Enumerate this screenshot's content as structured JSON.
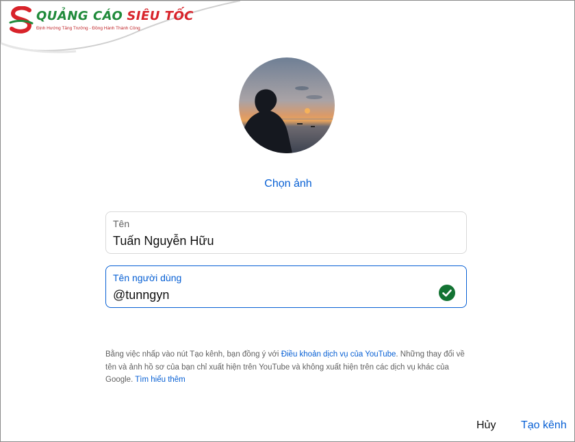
{
  "logo": {
    "brand_part1": "QUẢNG CÁO",
    "brand_part2": "SIÊU TỐC",
    "slogan": "Định Hướng Tăng Trưởng - Đồng Hành Thành Công",
    "colors": {
      "green": "#1f8a3a",
      "red": "#d8232a"
    }
  },
  "profile": {
    "choose_photo_label": "Chọn ảnh"
  },
  "form": {
    "name_label": "Tên",
    "name_value": "Tuấn Nguyễn Hữu",
    "username_label": "Tên người dùng",
    "username_value": "@tunngyn",
    "username_status_icon": "check-circle-icon"
  },
  "terms": {
    "text_before": "Bằng việc nhấp vào nút Tạo kênh, bạn đồng ý với ",
    "tos_link": "Điều khoản dịch vụ của YouTube",
    "text_after": ". Những thay đổi về tên và ảnh hồ sơ của bạn chỉ xuất hiện trên YouTube và không xuất hiện trên các dịch vụ khác của Google. ",
    "learn_more_link": "Tìm hiểu thêm"
  },
  "actions": {
    "cancel_label": "Hủy",
    "create_label": "Tạo kênh"
  },
  "colors": {
    "accent": "#065fd4",
    "success": "#137333"
  }
}
